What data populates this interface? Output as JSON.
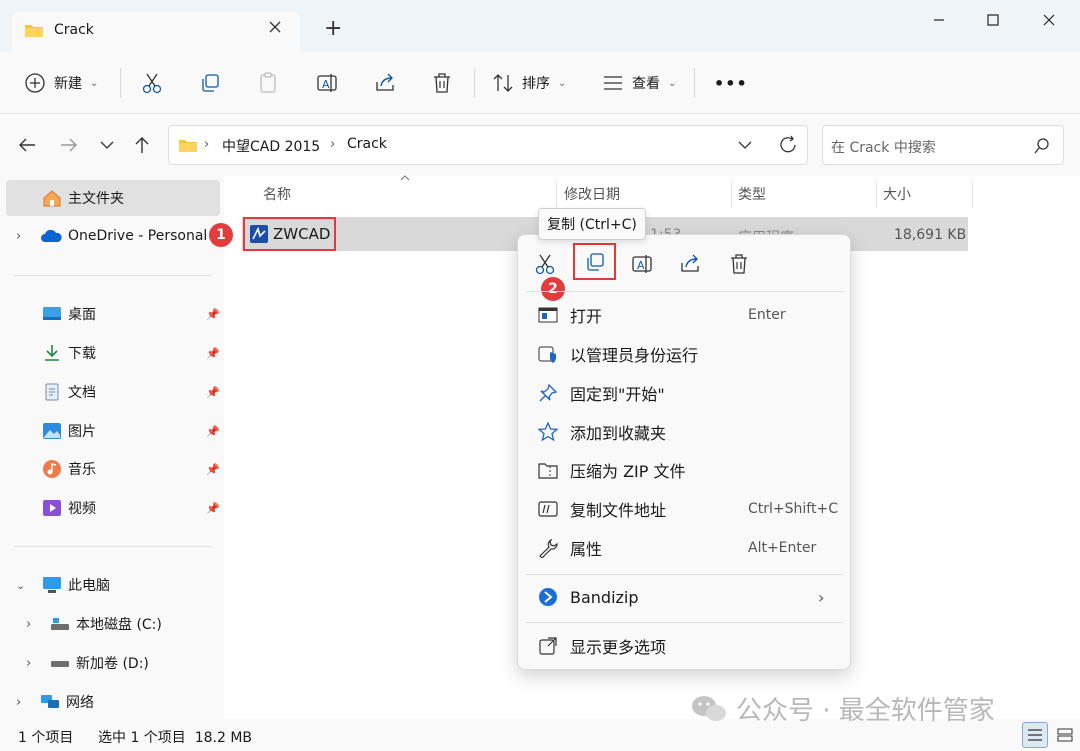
{
  "tab": {
    "title": "Crack",
    "new_tab": "+"
  },
  "toolbar": {
    "new_label": "新建",
    "sort_label": "排序",
    "view_label": "查看",
    "more_label": "•••"
  },
  "address": {
    "segments": [
      "中望CAD 2015",
      "Crack"
    ],
    "search_placeholder": "在 Crack 中搜索"
  },
  "nav": {
    "home": "主文件夹",
    "onedrive": "OneDrive - Personal",
    "quick": [
      "桌面",
      "下载",
      "文档",
      "图片",
      "音乐",
      "视频"
    ],
    "this_pc": "此电脑",
    "drive_c": "本地磁盘 (C:)",
    "drive_d": "新加卷 (D:)",
    "network": "网络"
  },
  "columns": {
    "name": "名称",
    "modified": "修改日期",
    "type": "类型",
    "size": "大小"
  },
  "file": {
    "name": "ZWCAD",
    "modified_partial": "1:53",
    "type_partial": "应用程序",
    "size": "18,691 KB"
  },
  "tooltip": "复制 (Ctrl+C)",
  "menu": {
    "open": {
      "label": "打开",
      "shortcut": "Enter"
    },
    "run_admin": {
      "label": "以管理员身份运行"
    },
    "pin_start": {
      "label": "固定到\"开始\""
    },
    "add_fav": {
      "label": "添加到收藏夹"
    },
    "zip": {
      "label": "压缩为 ZIP 文件"
    },
    "copy_path": {
      "label": "复制文件地址",
      "shortcut": "Ctrl+Shift+C"
    },
    "properties": {
      "label": "属性",
      "shortcut": "Alt+Enter"
    },
    "bandizip": {
      "label": "Bandizip"
    },
    "more": {
      "label": "显示更多选项"
    }
  },
  "badges": {
    "one": "1",
    "two": "2"
  },
  "status": {
    "count": "1 个项目",
    "selected": "选中 1 个项目  18.2 MB"
  },
  "watermark": "公众号 · 最全软件管家",
  "colors": {
    "accent": "#005fb8",
    "highlight_red": "#e03a3a",
    "folder": "#f5c342"
  }
}
